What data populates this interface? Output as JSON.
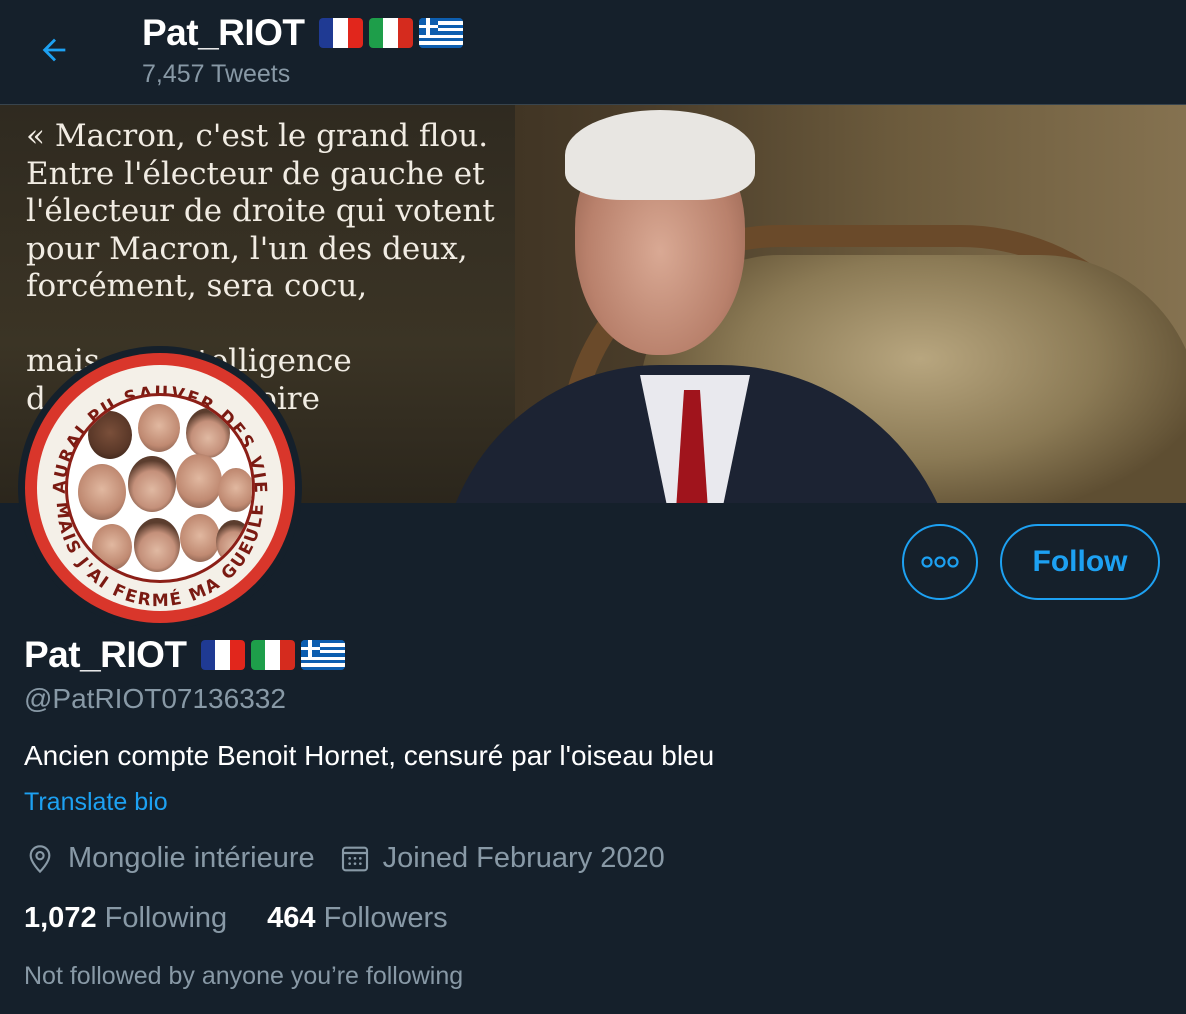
{
  "header": {
    "title": "Pat_RIOT",
    "tweet_count": "7,457 Tweets",
    "back_icon": "arrow-left-icon"
  },
  "flags": [
    "france-flag",
    "italy-flag",
    "greece-flag"
  ],
  "banner": {
    "quote": "« Macron, c'est le grand flou.\nEntre l'électeur de gauche et\nl'électeur de droite qui votent\npour Macron, l'un des deux,\nforcément, sera cocu,\n\nmais ... l'intelligence\nd ... de faire croire\n... l'autre"
  },
  "avatar": {
    "ring_top": "J'AURAI PU SAUVER DES VIES",
    "ring_bottom": "MAIS J'AI FERMÉ MA GUEULE"
  },
  "actions": {
    "more_icon": "more-options-icon",
    "follow_label": "Follow"
  },
  "profile": {
    "name": "Pat_RIOT",
    "handle": "@PatRIOT07136332",
    "bio": "Ancien compte Benoit Hornet, censuré par l'oiseau bleu",
    "translate_label": "Translate bio",
    "location": "Mongolie intérieure",
    "joined": "Joined February 2020",
    "following_count": "1,072",
    "following_label": "Following",
    "followers_count": "464",
    "followers_label": "Followers",
    "not_followed_text": "Not followed by anyone you’re following"
  },
  "colors": {
    "background": "#15202b",
    "accent": "#1da1f2",
    "secondary_text": "#8899a6",
    "divider": "#38444d"
  }
}
